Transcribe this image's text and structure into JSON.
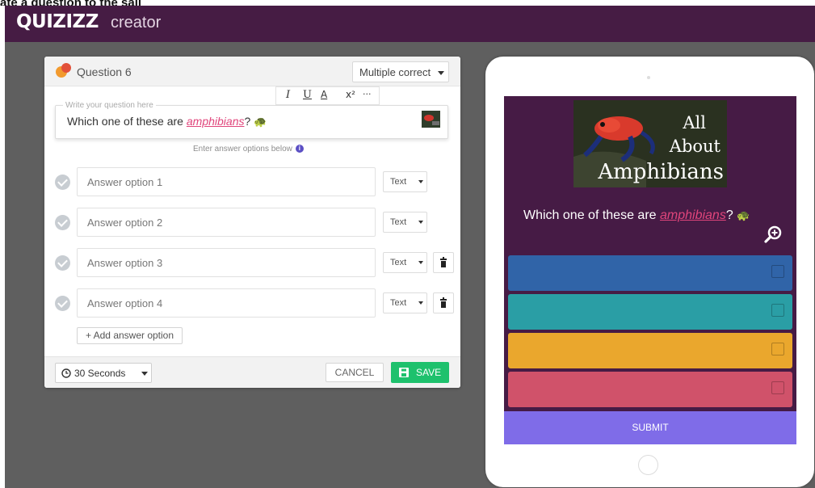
{
  "top_caption": "ate a question to the sail",
  "header": {
    "logo": "QUIZIZZ",
    "logo_sub": "creator"
  },
  "editor": {
    "title": "Question 6",
    "question_type": "Multiple correct",
    "formatting": {
      "italic": "I",
      "underline": "U",
      "text_color": "A",
      "superscript": "x²",
      "more": "···"
    },
    "question": {
      "placeholder": "Write your question here",
      "text_before": "Which one of these are ",
      "link_word": "amphibians",
      "text_after": "?",
      "emoji": "🐢"
    },
    "enter_hint": "Enter answer options below",
    "info_mark": "i",
    "answers": [
      {
        "placeholder": "Answer option 1",
        "type": "Text",
        "deletable": false
      },
      {
        "placeholder": "Answer option 2",
        "type": "Text",
        "deletable": false
      },
      {
        "placeholder": "Answer option 3",
        "type": "Text",
        "deletable": true
      },
      {
        "placeholder": "Answer option 4",
        "type": "Text",
        "deletable": true
      }
    ],
    "add_answer": "+ Add answer option",
    "timer": "30 Seconds",
    "cancel": "CANCEL",
    "save": "SAVE"
  },
  "preview": {
    "image_title": [
      "All",
      "About",
      "Amphibians"
    ],
    "question_before": "Which one of these are ",
    "question_link": "amphibians",
    "question_after": "?",
    "emoji": "🐢",
    "options": [
      {
        "color": "#3064a8"
      },
      {
        "color": "#2a9ea5"
      },
      {
        "color": "#eaa72d"
      },
      {
        "color": "#d0526a"
      }
    ],
    "submit": "SUBMIT"
  },
  "colors": {
    "header": "#461c44",
    "save": "#1ec16d",
    "submit": "#7f6ce8",
    "link": "#e0457b"
  }
}
